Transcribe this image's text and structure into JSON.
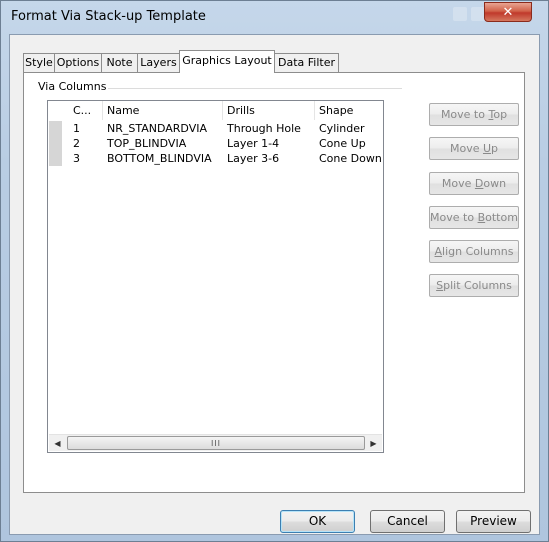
{
  "window": {
    "title": "Format Via Stack-up Template",
    "close_glyph": "✕"
  },
  "tabs": [
    {
      "label": "Style"
    },
    {
      "label": "Options"
    },
    {
      "label": "Note"
    },
    {
      "label": "Layers"
    },
    {
      "label": "Graphics Layout",
      "active": true
    },
    {
      "label": "Data Filter"
    }
  ],
  "group": {
    "label": "Via Columns"
  },
  "list": {
    "columns": [
      "C...",
      "Name",
      "Drills",
      "Shape"
    ],
    "rows": [
      [
        "1",
        "NR_STANDARDVIA",
        "Through Hole",
        "Cylinder"
      ],
      [
        "2",
        "TOP_BLINDVIA",
        "Layer 1-4",
        "Cone Up"
      ],
      [
        "3",
        "BOTTOM_BLINDVIA",
        "Layer 3-6",
        "Cone Down"
      ]
    ],
    "scroll_left": "◀",
    "scroll_right": "▶",
    "thumb_grip": "III"
  },
  "side_buttons": {
    "move_top": {
      "pre": "Move to ",
      "key": "T",
      "post": "op"
    },
    "move_up": {
      "pre": "Move ",
      "key": "U",
      "post": "p"
    },
    "move_down": {
      "pre": "Move ",
      "key": "D",
      "post": "own"
    },
    "move_bottom": {
      "pre": "Move to ",
      "key": "B",
      "post": "ottom"
    },
    "align_columns": {
      "pre": "",
      "key": "A",
      "post": "lign Columns"
    },
    "split_columns": {
      "pre": "",
      "key": "S",
      "post": "plit Columns"
    }
  },
  "bottom_buttons": {
    "ok": "OK",
    "cancel": "Cancel",
    "preview": "Preview"
  }
}
